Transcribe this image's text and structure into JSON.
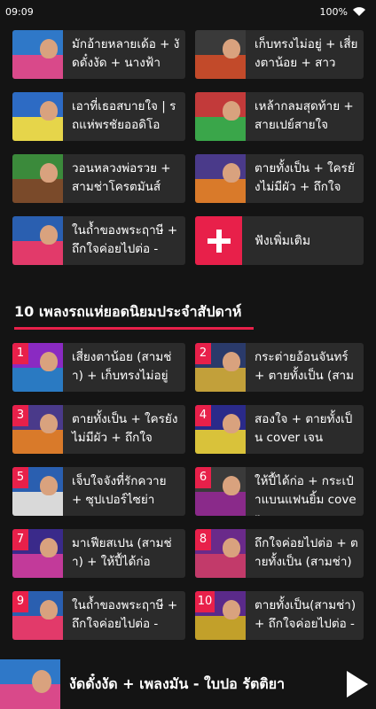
{
  "status": {
    "time": "09:09",
    "battery": "100%"
  },
  "recent": [
    {
      "title": "มักอ้ายหลายเด้อ + งัดดั๋งงัด + นางฟ้า",
      "c1": "#2f78c8",
      "c2": "#d9498a"
    },
    {
      "title": "เก็บทรงไม่อยู่ + เสี่ยงตาน้อย + สาว",
      "c1": "#3a3a3a",
      "c2": "#c24a2a"
    },
    {
      "title": "เอาที่เธอสบายใจ | รถแห่พรชัยออดิโอ",
      "c1": "#2d6bc4",
      "c2": "#e6d54a"
    },
    {
      "title": "เหล้ากลมสุดท้าย + สายเปย์สายใจ",
      "c1": "#c23a3a",
      "c2": "#3aa64a"
    },
    {
      "title": "วอนหลวงพ่อรวย + สามช่าโครตมันส์",
      "c1": "#3b8a3b",
      "c2": "#7a4a2a"
    },
    {
      "title": "ตายทั้งเป็น + ใครยังไม่มีผัว + ถึกใจ",
      "c1": "#4a3a8a",
      "c2": "#d97a2a"
    },
    {
      "title": "ในถ้ำของพระฤาษี + ถึกใจค่อยไปต่อ -",
      "c1": "#2a5fb0",
      "c2": "#e23a6a"
    }
  ],
  "more": {
    "label": "ฟังเพิ่มเติม"
  },
  "section": {
    "title": "10 เพลงรถแห่ยอดนิยมประจำสัปดาห์"
  },
  "top10": [
    {
      "rank": "1",
      "title": "เสี่ยงตาน้อย (สามช่า) + เก็บทรงไม่อยู่",
      "c1": "#8a2ac2",
      "c2": "#2a7ac2"
    },
    {
      "rank": "2",
      "title": "กระต่ายอ้อนจันทร์ + ตายทั้งเป็น (สาม",
      "c1": "#2a3a6a",
      "c2": "#c2a03a"
    },
    {
      "rank": "3",
      "title": "ตายทั้งเป็น + ใครยังไม่มีผัว + ถึกใจ",
      "c1": "#4a3a8a",
      "c2": "#d97a2a"
    },
    {
      "rank": "4",
      "title": "สองใจ + ตายทั้งเป็น cover เจน",
      "c1": "#2a2a8a",
      "c2": "#d9c23a"
    },
    {
      "rank": "5",
      "title": "เจ็บใจจังที่รักควาย + ซุปเปอร์ไซย่า",
      "c1": "#2a5fb0",
      "c2": "#d9d9d9"
    },
    {
      "rank": "6",
      "title": "ให้ปี้ได้ก่อ + กระเป๋าแบนแฟนยิ้ม cover",
      "c1": "#3a3a3a",
      "c2": "#8a2a8a"
    },
    {
      "rank": "7",
      "title": "มาเฟียสเปน (สามช่า) + ให้ปี้ได้ก่อ",
      "c1": "#3a2a8a",
      "c2": "#c23a9a"
    },
    {
      "rank": "8",
      "title": "ถึกใจค่อยไปต่อ + ตายทั้งเป็น (สามช่า)",
      "c1": "#6a2a8a",
      "c2": "#c23a6a"
    },
    {
      "rank": "9",
      "title": "ในถ้ำของพระฤาษี + ถึกใจค่อยไปต่อ -",
      "c1": "#2a5fb0",
      "c2": "#e23a6a"
    },
    {
      "rank": "10",
      "title": "ตายทั้งเป็น(สามช่า) + ถึกใจค่อยไปต่อ -",
      "c1": "#5a2a8a",
      "c2": "#c2a02a"
    }
  ],
  "player": {
    "title": "งัดดั๋งงัด + เพลงมัน - ใบปอ รัตติยา"
  },
  "colors": {
    "accent": "#e8204a",
    "card": "#2b2b2b",
    "background": "#141414"
  }
}
